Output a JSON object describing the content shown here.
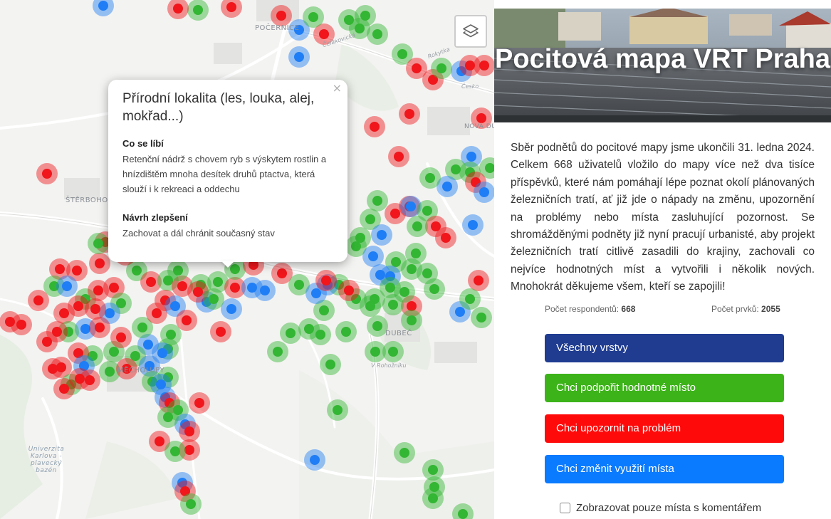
{
  "map": {
    "labels": [
      "POČERNICE",
      "Čelákovická",
      "Rokytka",
      "Česko",
      "NOVÁ DUB",
      "ŠTĚRBOHOLY",
      "DUBEČ",
      "MĚCHOLUPY",
      "V Rohožníku"
    ],
    "university_label": "Univerzita Karlova - plavecký bazén",
    "layers_icon": "layers-icon",
    "marker_colors": {
      "green": "#33b633",
      "red": "#f0161b",
      "blue": "#1f7ef5"
    }
  },
  "popup": {
    "title": "Přírodní lokalita (les, louka, alej, mokřad...)",
    "close": "×",
    "likes_heading": "Co se líbí",
    "likes_text": "Retenční nádrž s chovem ryb s výskytem rostlin a hnízdištěm mnoha desítek druhů ptactva, která slouží i k rekreaci a oddechu",
    "improve_heading": "Návrh zlepšení",
    "improve_text": "Zachovat a dál chránit současný stav"
  },
  "sidebar": {
    "title": "Pocitová mapa VRT Praha",
    "description": "Sběr podnětů do pocitové mapy jsme ukončili 31. ledna 2024. Celkem 668 uživatelů vložilo do mapy více než dva tisíce příspěvků, které nám pomáhají lépe poznat okolí plánovaných železničních tratí, ať již jde o nápady na změnu, upozornění na problémy nebo místa zasluhující pozornost. Se shromážděnými podněty již nyní pracují urbanisté, aby projekt železničních tratí citlivě zasadili do krajiny, zachovali co nejvíce hodnotných míst a vytvořili i několik nových. Mnohokrát děkujeme všem, kteří se zapojili!",
    "respondents_label": "Počet respondentů:",
    "respondents_value": "668",
    "items_label": "Počet prvků:",
    "items_value": "2055",
    "buttons": {
      "all": "Všechny vrstvy",
      "support": "Chci podpořit hodnotné místo",
      "problem": "Chci upozornit na problém",
      "change": "Chci změnit využití místa"
    },
    "button_colors": {
      "all": "#1f3c91",
      "support": "#3db31a",
      "problem": "#ff0a0a",
      "change": "#0a7bff"
    },
    "checkbox_label": "Zobrazovat pouze místa s komentářem"
  }
}
